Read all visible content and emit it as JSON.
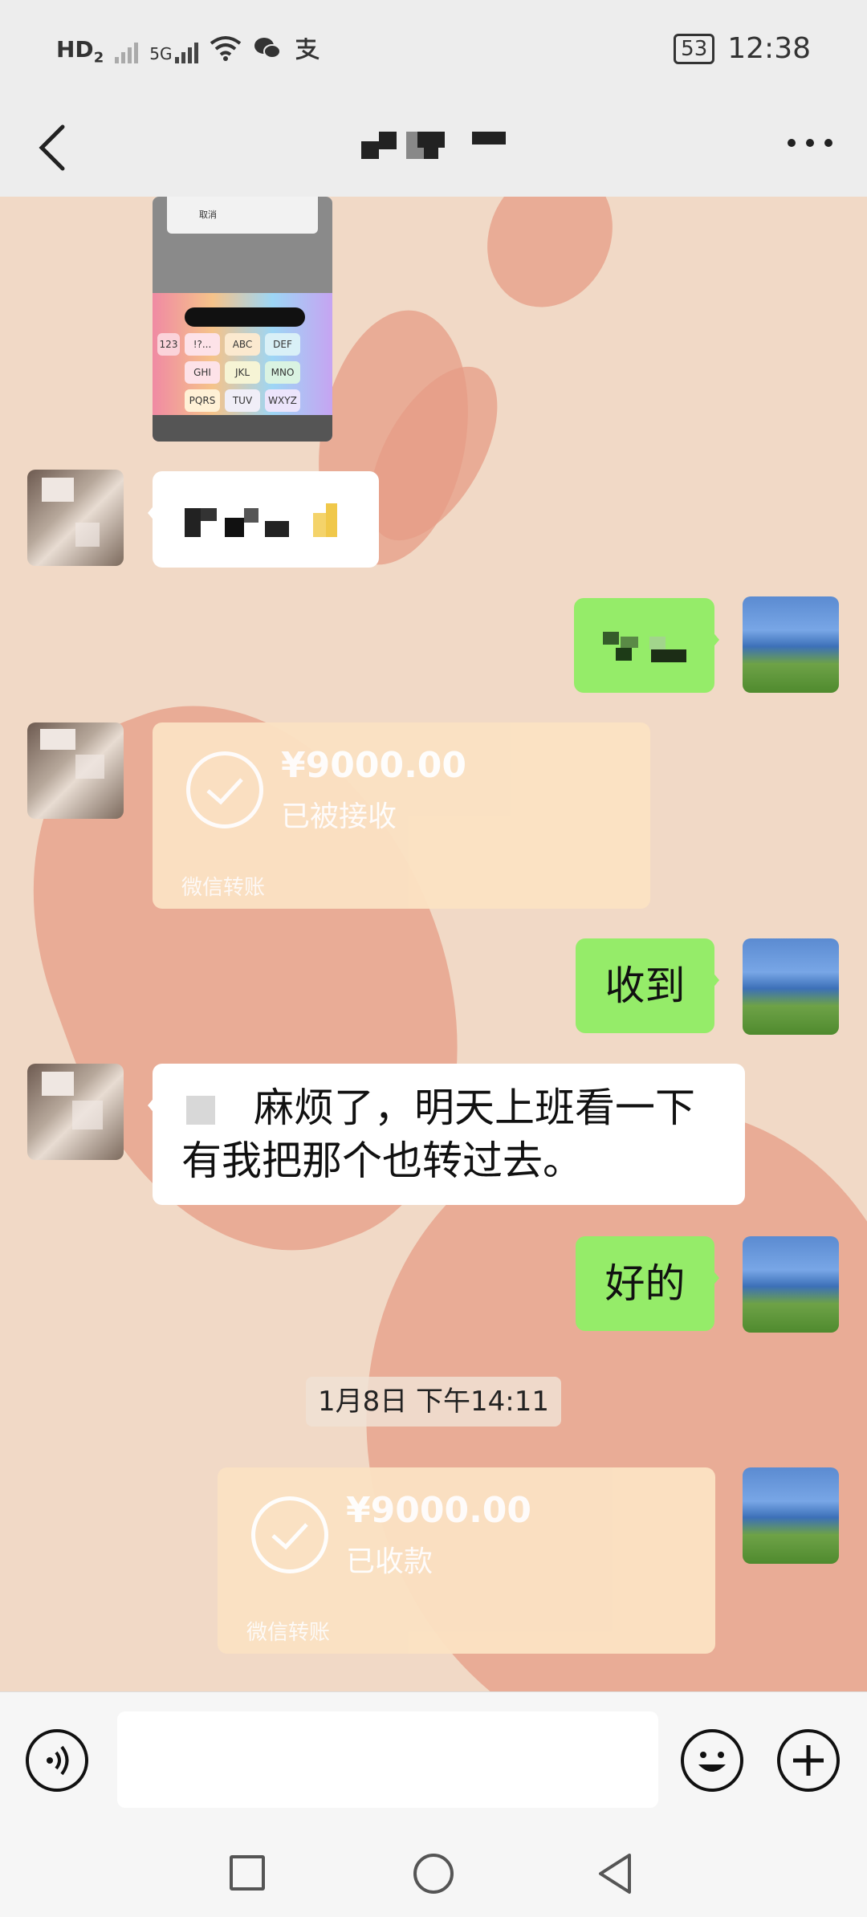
{
  "status_bar": {
    "left_icons": [
      "hd-icon",
      "signal-icon",
      "signal-5g-icon",
      "wifi-icon",
      "wechat-icon",
      "alipay-icon"
    ],
    "hd_label": "HD",
    "sim_number": "2",
    "network_label": "5G",
    "battery": "53",
    "time": "12:38"
  },
  "nav": {
    "title": ""
  },
  "messages": {
    "m1": {
      "text": ""
    },
    "m2": {
      "text": ""
    },
    "transfer1": {
      "amount": "¥9000.00",
      "status": "已被接收",
      "label": "微信转账"
    },
    "m3": {
      "text": "收到"
    },
    "m4": {
      "line1": "麻烦了，明天上班看一下",
      "line2": "有我把那个也转过去。"
    },
    "m5": {
      "text": "好的"
    },
    "timestamp": "1月8日 下午14:11",
    "transfer2": {
      "amount": "¥9000.00",
      "status": "已收款",
      "label": "微信转账"
    }
  },
  "thumbnail": {
    "cancel": "取消",
    "keys": [
      "123",
      "!?...",
      "ABC",
      "DEF",
      "GHI",
      "JKL",
      "MNO",
      "PQRS",
      "TUV",
      "WXYZ"
    ]
  },
  "colors": {
    "chat_bg": "#f1d9c6",
    "green_bubble": "#95ec69",
    "transfer_bg": "#fbe2c3"
  }
}
